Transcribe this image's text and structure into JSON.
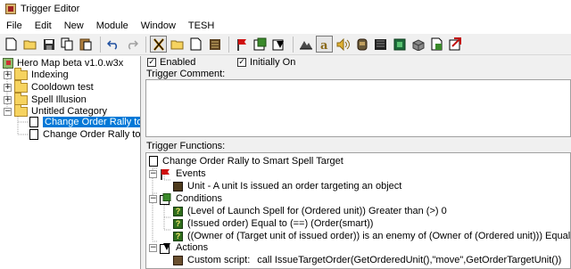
{
  "window": {
    "title": "Trigger Editor"
  },
  "menu": [
    "File",
    "Edit",
    "New",
    "Module",
    "Window",
    "TESH"
  ],
  "toolbar": {
    "buttons": [
      "new-doc-icon",
      "open-folder-icon",
      "save-icon",
      "copy-icon",
      "paste-icon",
      "undo-icon",
      "redo-icon",
      "cut-icon",
      "new-category-icon",
      "new-trigger-icon",
      "new-comment-icon",
      "new-event-icon",
      "new-condition-icon",
      "new-action-icon",
      "terrain-editor-icon",
      "trigger-editor-icon",
      "sound-editor-icon",
      "object-editor-icon",
      "campaign-editor-icon",
      "ai-editor-icon",
      "object-manager-icon",
      "import-manager-icon",
      "test-map-icon"
    ]
  },
  "tree": {
    "root": "Hero Map beta v1.0.w3x",
    "items": [
      {
        "label": "Indexing"
      },
      {
        "label": "Cooldown test"
      },
      {
        "label": "Spell Illusion"
      },
      {
        "label": "Untitled Category"
      }
    ],
    "triggers": [
      {
        "label": "Change Order Rally to Sm",
        "selected": true
      },
      {
        "label": "Change Order Rally to Sm",
        "selected": false
      }
    ]
  },
  "trigger": {
    "enabled_label": "Enabled",
    "initially_on_label": "Initially On",
    "comment_label": "Trigger Comment:",
    "functions_label": "Trigger Functions:",
    "name": "Change Order Rally to Smart Spell Target",
    "events_label": "Events",
    "event_1": "Unit - A unit Is issued an order targeting an object",
    "conditions_label": "Conditions",
    "condition_1": "(Level of Launch Spell  for (Ordered unit)) Greater than (>) 0",
    "condition_2": "(Issued order) Equal to (==) (Order(smart))",
    "condition_3": "((Owner of (Target unit of issued order)) is an enemy of (Owner of (Ordered unit))) Equal to (==) False",
    "actions_label": "Actions",
    "action_1_prefix": "Custom script:",
    "action_1_code": "call IssueTargetOrder(GetOrderedUnit(),\"move\",GetOrderTargetUnit())"
  }
}
